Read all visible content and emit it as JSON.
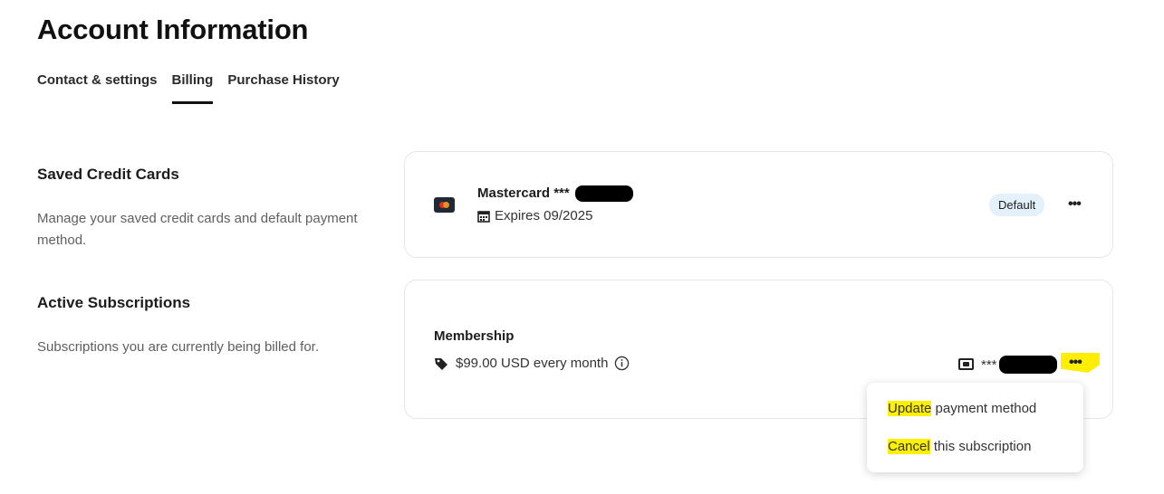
{
  "page": {
    "title": "Account Information"
  },
  "tabs": [
    {
      "label": "Contact & settings"
    },
    {
      "label": "Billing"
    },
    {
      "label": "Purchase History"
    }
  ],
  "saved_cards": {
    "title": "Saved Credit Cards",
    "description": "Manage your saved credit cards and default payment method.",
    "card": {
      "name": "Mastercard ***",
      "expiry": "Expires 09/2025",
      "badge": "Default",
      "more": "•••"
    }
  },
  "subscriptions": {
    "title": "Active Subscriptions",
    "description": "Subscriptions you are currently being billed for.",
    "item": {
      "name": "Membership",
      "price": "$99.00 USD every month",
      "payment_masked": "***",
      "more": "•••"
    }
  },
  "menu": {
    "update_word": "Update",
    "update_rest": " payment method",
    "cancel_word": "Cancel",
    "cancel_rest": " this subscription"
  },
  "colors": {
    "highlight": "#ffee00",
    "badge_bg": "#e4f1fb"
  }
}
